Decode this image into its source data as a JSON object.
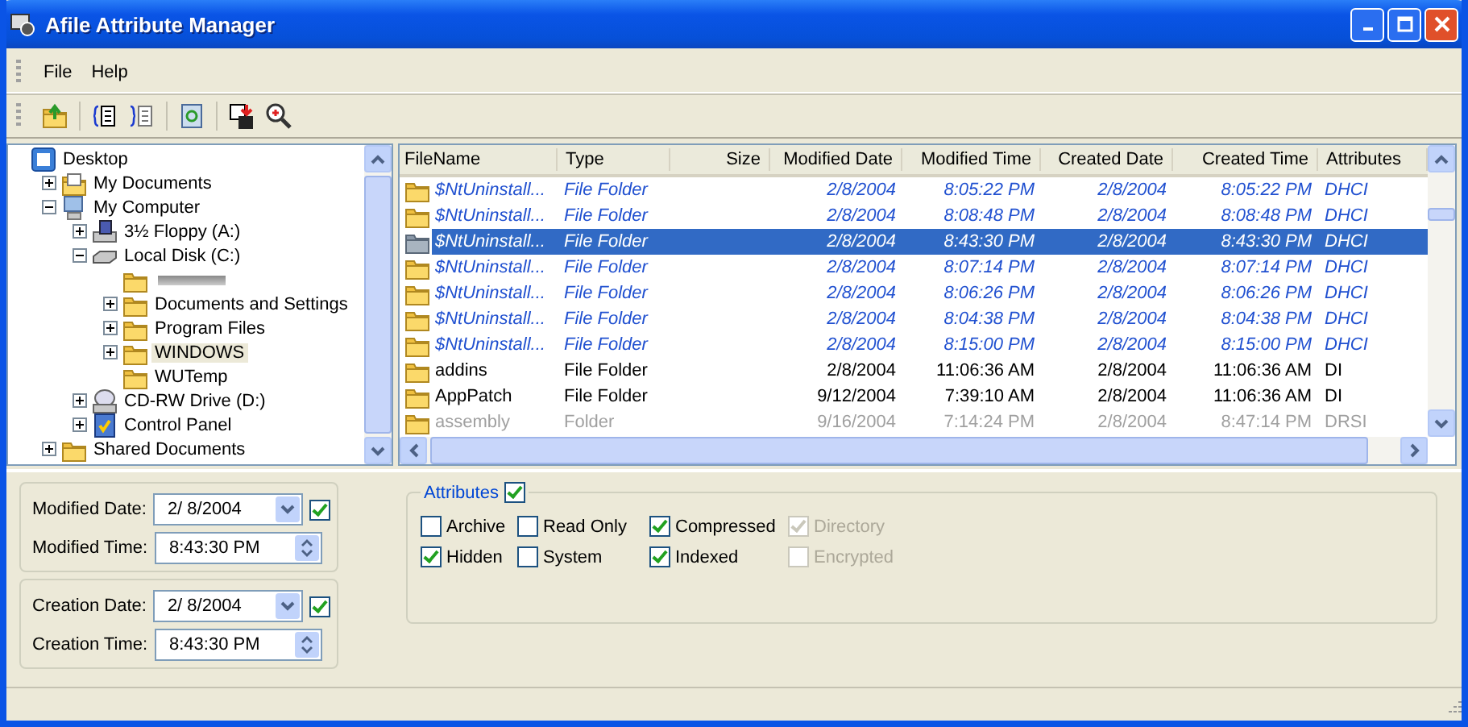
{
  "window": {
    "title": "Afile Attribute Manager"
  },
  "menu": [
    "File",
    "Help"
  ],
  "tree": [
    {
      "label": "Desktop",
      "kind": "desktop",
      "selected": false,
      "children": [
        {
          "label": "My Documents",
          "kind": "documents",
          "expanded": false,
          "selected": false
        },
        {
          "label": "My Computer",
          "kind": "computer",
          "expanded": true,
          "selected": false,
          "children": [
            {
              "label": "3½ Floppy (A:)",
              "kind": "floppy",
              "expanded": false,
              "selected": false
            },
            {
              "label": "Local Disk (C:)",
              "kind": "disk",
              "expanded": true,
              "selected": false,
              "children": [
                {
                  "kind": "folder",
                  "selected": false
                },
                {
                  "label": "Documents and Settings",
                  "kind": "folder",
                  "expanded": false,
                  "selected": false
                },
                {
                  "label": "Program Files",
                  "kind": "folder",
                  "expanded": false,
                  "selected": false
                },
                {
                  "label": "WINDOWS",
                  "kind": "folder",
                  "expanded": false,
                  "selected": true
                },
                {
                  "label": "WUTemp",
                  "kind": "folder",
                  "selected": false
                }
              ]
            },
            {
              "label": "CD-RW Drive (D:)",
              "kind": "cdrom",
              "expanded": false,
              "selected": false
            },
            {
              "label": "Control Panel",
              "kind": "control-panel",
              "expanded": false,
              "selected": false
            }
          ]
        },
        {
          "label": "Shared Documents",
          "kind": "folder",
          "expanded": false,
          "selected": false
        }
      ]
    }
  ],
  "list": {
    "columns": [
      "FileName",
      "Type",
      "Size",
      "Modified Date",
      "Modified Time",
      "Created Date",
      "Created Time",
      "Attributes"
    ],
    "rows": [
      {
        "name": "$NtUninstall...",
        "type": "File Folder",
        "modified_date": "2/8/2004",
        "modified_time": "8:05:22 PM",
        "created_date": "2/8/2004",
        "created_time": "8:05:22 PM",
        "attributes": "DHCI",
        "kind": "compressed",
        "selected": false
      },
      {
        "name": "$NtUninstall...",
        "type": "File Folder",
        "modified_date": "2/8/2004",
        "modified_time": "8:08:48 PM",
        "created_date": "2/8/2004",
        "created_time": "8:08:48 PM",
        "attributes": "DHCI",
        "kind": "compressed",
        "selected": false
      },
      {
        "name": "$NtUninstall...",
        "type": "File Folder",
        "modified_date": "2/8/2004",
        "modified_time": "8:43:30 PM",
        "created_date": "2/8/2004",
        "created_time": "8:43:30 PM",
        "attributes": "DHCI",
        "kind": "compressed",
        "selected": true
      },
      {
        "name": "$NtUninstall...",
        "type": "File Folder",
        "modified_date": "2/8/2004",
        "modified_time": "8:07:14 PM",
        "created_date": "2/8/2004",
        "created_time": "8:07:14 PM",
        "attributes": "DHCI",
        "kind": "compressed",
        "selected": false
      },
      {
        "name": "$NtUninstall...",
        "type": "File Folder",
        "modified_date": "2/8/2004",
        "modified_time": "8:06:26 PM",
        "created_date": "2/8/2004",
        "created_time": "8:06:26 PM",
        "attributes": "DHCI",
        "kind": "compressed",
        "selected": false
      },
      {
        "name": "$NtUninstall...",
        "type": "File Folder",
        "modified_date": "2/8/2004",
        "modified_time": "8:04:38 PM",
        "created_date": "2/8/2004",
        "created_time": "8:04:38 PM",
        "attributes": "DHCI",
        "kind": "compressed",
        "selected": false
      },
      {
        "name": "$NtUninstall...",
        "type": "File Folder",
        "modified_date": "2/8/2004",
        "modified_time": "8:15:00 PM",
        "created_date": "2/8/2004",
        "created_time": "8:15:00 PM",
        "attributes": "DHCI",
        "kind": "compressed",
        "selected": false
      },
      {
        "name": "addins",
        "type": "File Folder",
        "modified_date": "2/8/2004",
        "modified_time": "11:06:36 AM",
        "created_date": "2/8/2004",
        "created_time": "11:06:36 AM",
        "attributes": "DI",
        "kind": "normal",
        "selected": false
      },
      {
        "name": "AppPatch",
        "type": "File Folder",
        "modified_date": "9/12/2004",
        "modified_time": "7:39:10 AM",
        "created_date": "2/8/2004",
        "created_time": "11:06:36 AM",
        "attributes": "DI",
        "kind": "normal",
        "selected": false
      },
      {
        "name": "assembly",
        "type": "Folder",
        "modified_date": "9/16/2004",
        "modified_time": "7:14:24 PM",
        "created_date": "2/8/2004",
        "created_time": "8:47:14 PM",
        "attributes": "DRSI",
        "kind": "dim",
        "selected": false
      }
    ]
  },
  "dates": [
    [
      {
        "label": "Modified Date:",
        "value": "2/  8/2004",
        "kind": "date",
        "checked": true
      },
      {
        "label": "Modified Time:",
        "value": "8:43:30 PM",
        "kind": "time"
      }
    ],
    [
      {
        "label": "Creation Date:",
        "value": "2/  8/2004",
        "kind": "date",
        "checked": true
      },
      {
        "label": "Creation Time:",
        "value": "8:43:30 PM",
        "kind": "time"
      }
    ]
  ],
  "attributes": {
    "label": "Attributes",
    "checked": true,
    "items": [
      {
        "label": "Archive",
        "checked": false,
        "disabled": false
      },
      {
        "label": "Read Only",
        "checked": false,
        "disabled": false
      },
      {
        "label": "Compressed",
        "checked": true,
        "disabled": false
      },
      {
        "label": "Directory",
        "checked": true,
        "disabled": true
      },
      {
        "label": "Hidden",
        "checked": true,
        "disabled": false
      },
      {
        "label": "System",
        "checked": false,
        "disabled": false
      },
      {
        "label": "Indexed",
        "checked": true,
        "disabled": false
      },
      {
        "label": "Encrypted",
        "checked": false,
        "disabled": true
      }
    ]
  }
}
